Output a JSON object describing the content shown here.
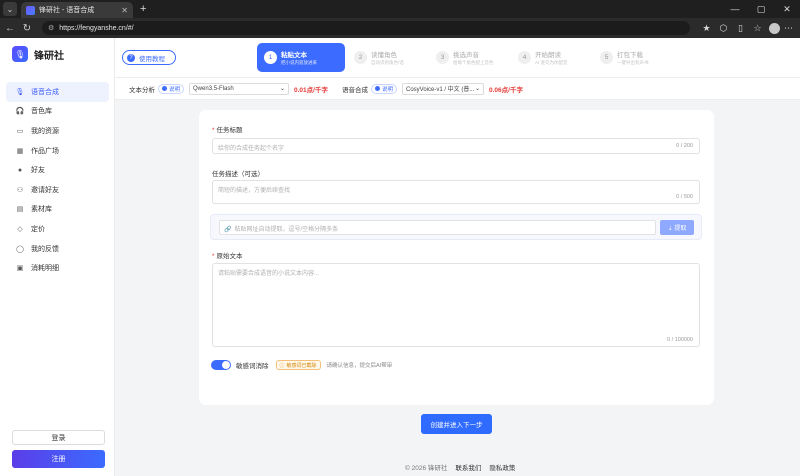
{
  "browser": {
    "tab_title": "锋研社 - 语音合成",
    "tab_close": "✕",
    "new_tab": "+",
    "url": "https://fengyanshe.cn/#/",
    "win_min": "—",
    "win_max": "▢",
    "win_close": "✕"
  },
  "sidebar": {
    "brand": "锋研社",
    "items": [
      {
        "label": "语音合成",
        "icon": "mic-icon",
        "glyph": "🎙"
      },
      {
        "label": "音色库",
        "icon": "headphones-icon",
        "glyph": "🎧"
      },
      {
        "label": "我的资源",
        "icon": "folder-icon",
        "glyph": "▭"
      },
      {
        "label": "作品广场",
        "icon": "gallery-icon",
        "glyph": "▦"
      },
      {
        "label": "好友",
        "icon": "user-icon",
        "glyph": "●"
      },
      {
        "label": "邀请好友",
        "icon": "invite-icon",
        "glyph": "⚇"
      },
      {
        "label": "素材库",
        "icon": "library-icon",
        "glyph": "▤"
      },
      {
        "label": "定价",
        "icon": "tag-icon",
        "glyph": "◇"
      },
      {
        "label": "我的反馈",
        "icon": "feedback-icon",
        "glyph": "◯"
      },
      {
        "label": "消耗明细",
        "icon": "receipt-icon",
        "glyph": "▣"
      }
    ],
    "login": "登录",
    "register": "注册"
  },
  "header": {
    "help": "使用教程",
    "steps": [
      {
        "num": "1",
        "title": "粘贴文本",
        "sub": "把小说内容放进来"
      },
      {
        "num": "2",
        "title": "读懂角色",
        "sub": "自动识别角色/话"
      },
      {
        "num": "3",
        "title": "挑选声音",
        "sub": "给每个角色配上音色"
      },
      {
        "num": "4",
        "title": "开始朗读",
        "sub": "AI 逐句为你配音"
      },
      {
        "num": "5",
        "title": "打包下载",
        "sub": "一键导出有声书"
      }
    ]
  },
  "config": {
    "text_label": "文本分析",
    "tag": "说明",
    "text_model": "Qwen3.5-Flash",
    "text_price": "0.01点/千字",
    "tts_label": "语音合成",
    "tts_model": "CosyVoice-v1 / 中文 (普...",
    "tts_price": "0.06点/千字"
  },
  "form": {
    "title_label": "任务标题",
    "title_placeholder": "给你的合成任务起个名字",
    "title_count": "0 / 200",
    "desc_label": "任务描述（可选）",
    "desc_placeholder": "简短的描述，方便后续查找",
    "desc_count": "0 / 500",
    "url_placeholder": "粘贴网址自动提取，逗号/空格分隔多条",
    "extract": "⇣ 提取",
    "text_label": "原始文本",
    "text_placeholder": "请粘贴需要合成语音的小说文本内容...",
    "text_count": "0 / 100000",
    "sensitive_label": "敏感词消除",
    "sensitive_badge": "敏感词已截除",
    "sensitive_note": "请确认信息，提交后AI帮审"
  },
  "next": "创建并进入下一步",
  "footer": {
    "copyright": "© 2026 锋研社",
    "contact": "联系我们",
    "privacy": "隐私政策"
  }
}
